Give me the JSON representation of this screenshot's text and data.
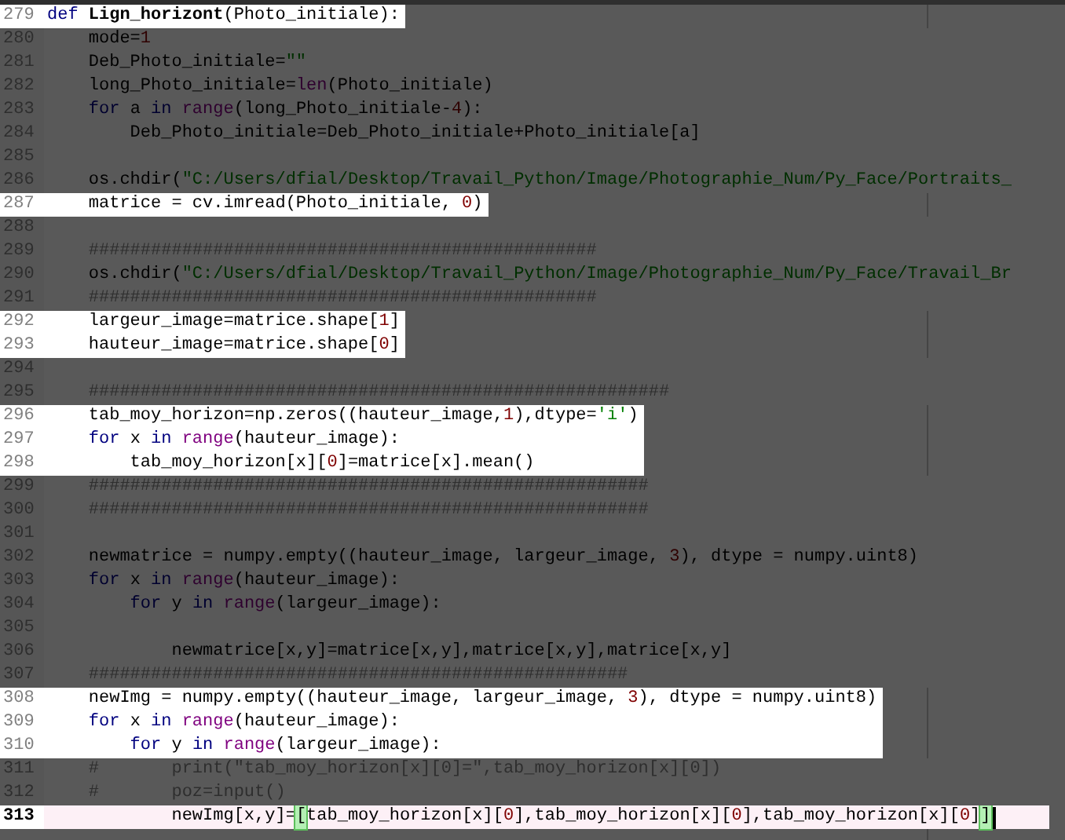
{
  "editor": {
    "lines": [
      {
        "number": "279",
        "highlighted": true,
        "current": false,
        "tokens": [
          {
            "kind": "keyword",
            "text": "def "
          },
          {
            "kind": "defname",
            "text": "Lign_horizont"
          },
          {
            "kind": "plain",
            "text": "(Photo_initiale):"
          }
        ]
      },
      {
        "number": "280",
        "highlighted": false,
        "current": false,
        "tokens": [
          {
            "kind": "plain",
            "text": "    mode="
          },
          {
            "kind": "number",
            "text": "1"
          }
        ]
      },
      {
        "number": "281",
        "highlighted": false,
        "current": false,
        "tokens": [
          {
            "kind": "plain",
            "text": "    Deb_Photo_initiale="
          },
          {
            "kind": "string",
            "text": "\"\""
          }
        ]
      },
      {
        "number": "282",
        "highlighted": false,
        "current": false,
        "tokens": [
          {
            "kind": "plain",
            "text": "    long_Photo_initiale="
          },
          {
            "kind": "builtin",
            "text": "len"
          },
          {
            "kind": "plain",
            "text": "(Photo_initiale)"
          }
        ]
      },
      {
        "number": "283",
        "highlighted": false,
        "current": false,
        "tokens": [
          {
            "kind": "keyword",
            "text": "    for"
          },
          {
            "kind": "plain",
            "text": " a "
          },
          {
            "kind": "keyword",
            "text": "in"
          },
          {
            "kind": "builtin",
            "text": " range"
          },
          {
            "kind": "plain",
            "text": "(long_Photo_initiale-"
          },
          {
            "kind": "number",
            "text": "4"
          },
          {
            "kind": "plain",
            "text": "):"
          }
        ]
      },
      {
        "number": "284",
        "highlighted": false,
        "current": false,
        "tokens": [
          {
            "kind": "plain",
            "text": "        Deb_Photo_initiale=Deb_Photo_initiale+Photo_initiale[a]"
          }
        ]
      },
      {
        "number": "285",
        "highlighted": false,
        "current": false
      },
      {
        "number": "286",
        "highlighted": false,
        "current": false,
        "tokens": [
          {
            "kind": "plain",
            "text": "    os.chdir("
          },
          {
            "kind": "string",
            "text": "\"C:/Users/dfial/Desktop/Travail_Python/Image/Photographie_Num/Py_Face/Portraits_"
          }
        ]
      },
      {
        "number": "287",
        "highlighted": true,
        "current": false,
        "tokens": [
          {
            "kind": "plain",
            "text": "    matrice = cv.imread(Photo_initiale, "
          },
          {
            "kind": "number",
            "text": "0"
          },
          {
            "kind": "plain",
            "text": ")"
          }
        ]
      },
      {
        "number": "288",
        "highlighted": false,
        "current": false
      },
      {
        "number": "289",
        "highlighted": false,
        "current": false,
        "tokens": [
          {
            "kind": "comment",
            "text": "    #################################################"
          }
        ]
      },
      {
        "number": "290",
        "highlighted": false,
        "current": false,
        "tokens": [
          {
            "kind": "plain",
            "text": "    os.chdir("
          },
          {
            "kind": "string",
            "text": "\"C:/Users/dfial/Desktop/Travail_Python/Image/Photographie_Num/Py_Face/Travail_Br"
          }
        ]
      },
      {
        "number": "291",
        "highlighted": false,
        "current": false,
        "tokens": [
          {
            "kind": "comment",
            "text": "    #################################################"
          }
        ]
      },
      {
        "number": "292",
        "highlighted": true,
        "current": false,
        "tokens": [
          {
            "kind": "plain",
            "text": "    largeur_image=matrice.shape["
          },
          {
            "kind": "number",
            "text": "1"
          },
          {
            "kind": "plain",
            "text": "]"
          }
        ]
      },
      {
        "number": "293",
        "highlighted": true,
        "current": false,
        "tokens": [
          {
            "kind": "plain",
            "text": "    hauteur_image=matrice.shape["
          },
          {
            "kind": "number",
            "text": "0"
          },
          {
            "kind": "plain",
            "text": "]"
          }
        ]
      },
      {
        "number": "294",
        "highlighted": false,
        "current": false
      },
      {
        "number": "295",
        "highlighted": false,
        "current": false,
        "tokens": [
          {
            "kind": "comment",
            "text": "    ########################################################"
          }
        ]
      },
      {
        "number": "296",
        "highlighted": true,
        "current": false,
        "tokens": [
          {
            "kind": "plain",
            "text": "    tab_moy_horizon=np.zeros((hauteur_image,"
          },
          {
            "kind": "number",
            "text": "1"
          },
          {
            "kind": "plain",
            "text": "),dtype="
          },
          {
            "kind": "string",
            "text": "'i'"
          },
          {
            "kind": "plain",
            "text": ")"
          }
        ]
      },
      {
        "number": "297",
        "highlighted": true,
        "current": false,
        "tokens": [
          {
            "kind": "keyword",
            "text": "    for"
          },
          {
            "kind": "plain",
            "text": " x "
          },
          {
            "kind": "keyword",
            "text": "in"
          },
          {
            "kind": "builtin",
            "text": " range"
          },
          {
            "kind": "plain",
            "text": "(hauteur_image):"
          }
        ]
      },
      {
        "number": "298",
        "highlighted": true,
        "current": false,
        "tokens": [
          {
            "kind": "plain",
            "text": "        tab_moy_horizon[x]["
          },
          {
            "kind": "number",
            "text": "0"
          },
          {
            "kind": "plain",
            "text": "]=matrice[x].mean()"
          }
        ]
      },
      {
        "number": "299",
        "highlighted": false,
        "current": false,
        "tokens": [
          {
            "kind": "comment",
            "text": "    ######################################################"
          }
        ]
      },
      {
        "number": "300",
        "highlighted": false,
        "current": false,
        "tokens": [
          {
            "kind": "comment",
            "text": "    ######################################################"
          }
        ]
      },
      {
        "number": "301",
        "highlighted": false,
        "current": false
      },
      {
        "number": "302",
        "highlighted": false,
        "current": false,
        "tokens": [
          {
            "kind": "plain",
            "text": "    newmatrice = numpy.empty((hauteur_image, largeur_image, "
          },
          {
            "kind": "number",
            "text": "3"
          },
          {
            "kind": "plain",
            "text": "), dtype = numpy.uint8)"
          }
        ]
      },
      {
        "number": "303",
        "highlighted": false,
        "current": false,
        "tokens": [
          {
            "kind": "keyword",
            "text": "    for"
          },
          {
            "kind": "plain",
            "text": " x "
          },
          {
            "kind": "keyword",
            "text": "in"
          },
          {
            "kind": "builtin",
            "text": " range"
          },
          {
            "kind": "plain",
            "text": "(hauteur_image):"
          }
        ]
      },
      {
        "number": "304",
        "highlighted": false,
        "current": false,
        "tokens": [
          {
            "kind": "keyword",
            "text": "        for"
          },
          {
            "kind": "plain",
            "text": " y "
          },
          {
            "kind": "keyword",
            "text": "in"
          },
          {
            "kind": "builtin",
            "text": " range"
          },
          {
            "kind": "plain",
            "text": "(largeur_image):"
          }
        ]
      },
      {
        "number": "305",
        "highlighted": false,
        "current": false
      },
      {
        "number": "306",
        "highlighted": false,
        "current": false,
        "tokens": [
          {
            "kind": "plain",
            "text": "            newmatrice[x,y]=matrice[x,y],matrice[x,y],matrice[x,y]"
          }
        ]
      },
      {
        "number": "307",
        "highlighted": false,
        "current": false,
        "tokens": [
          {
            "kind": "comment",
            "text": "    ####################################################"
          }
        ]
      },
      {
        "number": "308",
        "highlighted": true,
        "current": false,
        "tokens": [
          {
            "kind": "plain",
            "text": "    newImg = numpy.empty((hauteur_image, largeur_image, "
          },
          {
            "kind": "number",
            "text": "3"
          },
          {
            "kind": "plain",
            "text": "), dtype = numpy.uint8)"
          }
        ]
      },
      {
        "number": "309",
        "highlighted": true,
        "current": false,
        "tokens": [
          {
            "kind": "keyword",
            "text": "    for"
          },
          {
            "kind": "plain",
            "text": " x "
          },
          {
            "kind": "keyword",
            "text": "in"
          },
          {
            "kind": "builtin",
            "text": " range"
          },
          {
            "kind": "plain",
            "text": "(hauteur_image):"
          }
        ]
      },
      {
        "number": "310",
        "highlighted": true,
        "current": false,
        "tokens": [
          {
            "kind": "keyword",
            "text": "        for"
          },
          {
            "kind": "plain",
            "text": " y "
          },
          {
            "kind": "keyword",
            "text": "in"
          },
          {
            "kind": "builtin",
            "text": " range"
          },
          {
            "kind": "plain",
            "text": "(largeur_image):"
          }
        ]
      },
      {
        "number": "311",
        "highlighted": false,
        "current": false,
        "tokens": [
          {
            "kind": "comment",
            "text": "    #       print(\"tab_moy_horizon[x][0]=\",tab_moy_horizon[x][0])"
          }
        ]
      },
      {
        "number": "312",
        "highlighted": false,
        "current": false,
        "tokens": [
          {
            "kind": "comment",
            "text": "    #       poz=input()"
          }
        ]
      },
      {
        "number": "313",
        "highlighted": true,
        "current": true,
        "tokens": [
          {
            "kind": "plain",
            "text": "            newImg[x,y]="
          },
          {
            "kind": "match",
            "text": "["
          },
          {
            "kind": "plain",
            "text": "tab_moy_horizon[x]["
          },
          {
            "kind": "number",
            "text": "0"
          },
          {
            "kind": "plain",
            "text": "],tab_moy_horizon[x]["
          },
          {
            "kind": "number",
            "text": "0"
          },
          {
            "kind": "plain",
            "text": "],tab_moy_horizon[x]["
          },
          {
            "kind": "number",
            "text": "0"
          },
          {
            "kind": "plain",
            "text": "]"
          },
          {
            "kind": "match",
            "text": "]"
          }
        ]
      }
    ]
  }
}
